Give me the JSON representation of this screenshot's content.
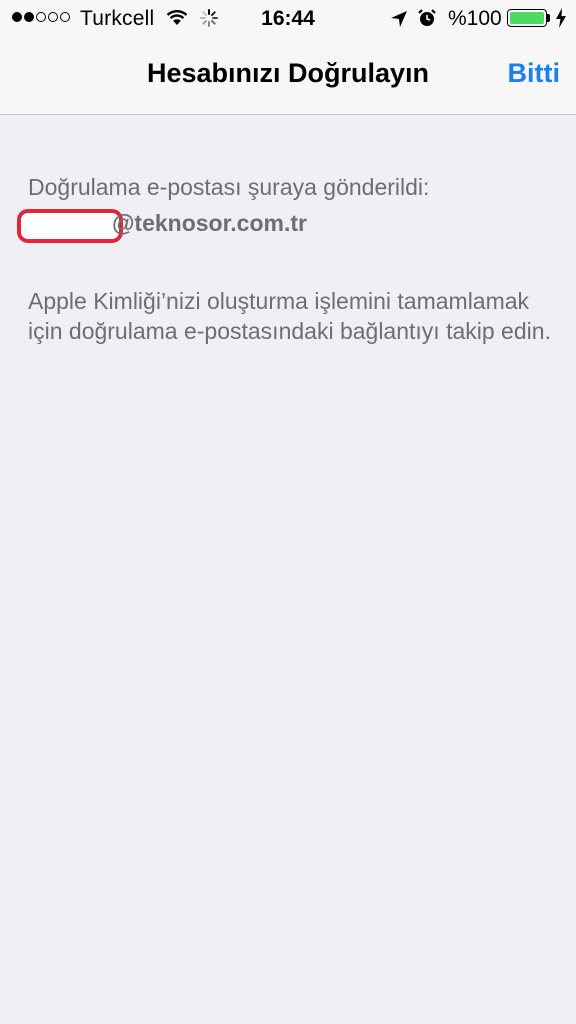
{
  "status_bar": {
    "signal_dots_filled": 2,
    "signal_dots_total": 5,
    "carrier": "Turkcell",
    "time": "16:44",
    "battery_percent": "%100",
    "battery_color": "#4cd964",
    "icons": [
      "wifi-icon",
      "activity-spinner-icon",
      "location-arrow-icon",
      "alarm-clock-icon",
      "battery-icon",
      "charging-bolt-icon"
    ]
  },
  "nav_bar": {
    "title": "Hesabınızı Doğrulayın",
    "done_label": "Bitti",
    "accent_color": "#1a7ef5"
  },
  "content": {
    "sent_label": "Doğrulama e-postası şuraya gönderildi:",
    "email_domain": "@teknosor.com.tr",
    "instructions": "Apple Kimliği’nizi oluşturma işlemini tamamlamak için doğrulama e-postasındaki bağlantıyı takip edin.",
    "redaction_color": "#e32636"
  }
}
